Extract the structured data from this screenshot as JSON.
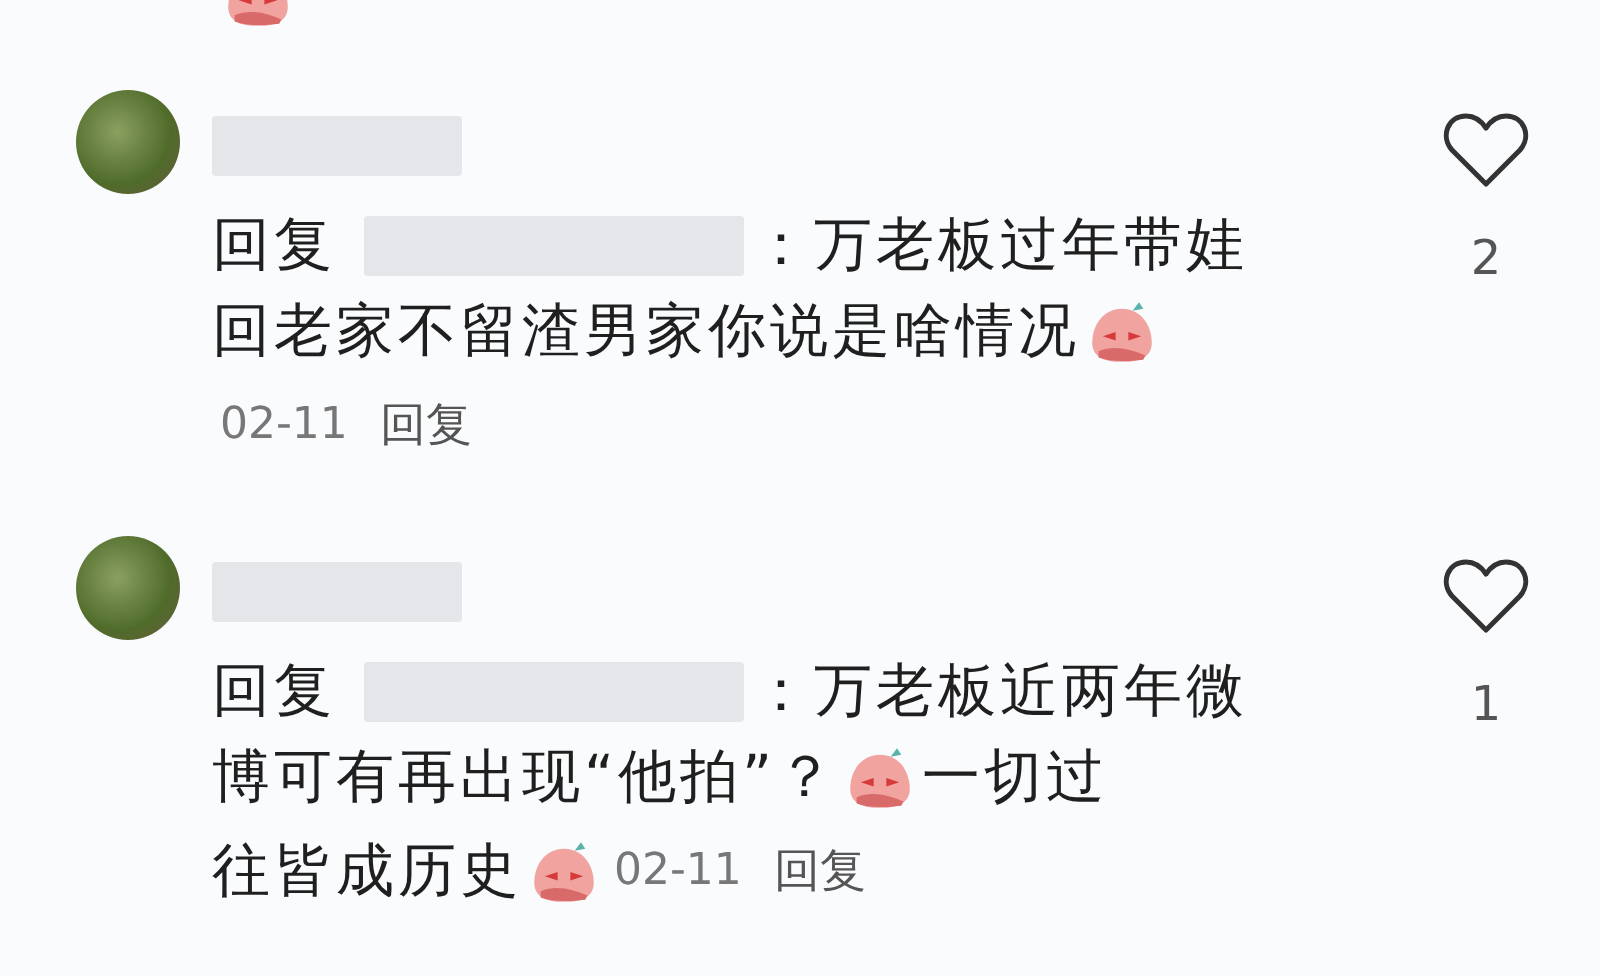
{
  "top_row": [
    {
      "kind": "emoji"
    }
  ],
  "comments": [
    {
      "likes": "2",
      "liked": false,
      "lines": [
        [
          {
            "kind": "text",
            "text": "回复"
          },
          {
            "kind": "blur"
          },
          {
            "kind": "text",
            "text": "：万老板过年带娃"
          }
        ],
        [
          {
            "kind": "text",
            "text": "回老家不留渣男家你说是啥情况"
          },
          {
            "kind": "emoji"
          }
        ],
        [
          {
            "kind": "date",
            "text": "02-11"
          },
          {
            "kind": "reply",
            "text": "回复"
          }
        ]
      ]
    },
    {
      "likes": "1",
      "liked": false,
      "lines": [
        [
          {
            "kind": "text",
            "text": "回复"
          },
          {
            "kind": "blur"
          },
          {
            "kind": "text",
            "text": "：万老板近两年微"
          }
        ],
        [
          {
            "kind": "text",
            "text": "博可有再出现“他拍”？"
          },
          {
            "kind": "emoji"
          },
          {
            "kind": "text",
            "text": "一切过"
          }
        ],
        [
          {
            "kind": "text",
            "text": "往皆成历史"
          },
          {
            "kind": "emoji"
          },
          {
            "kind": "date",
            "text": "02-11"
          },
          {
            "kind": "reply",
            "text": "回复"
          }
        ]
      ]
    }
  ]
}
